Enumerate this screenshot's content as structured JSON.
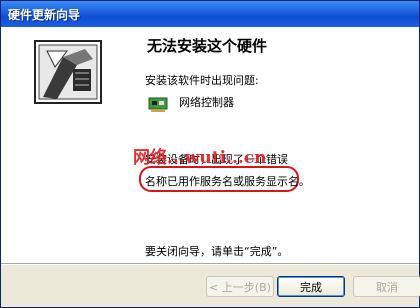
{
  "window": {
    "title": "硬件更新向导"
  },
  "wizard": {
    "heading": "无法安装这个硬件",
    "problem_label": "安装该软件时出现问题:",
    "device": {
      "name": "网络控制器",
      "icon": "network-card-icon"
    },
    "error_line1": "安装设备时，出现了一个错误",
    "error_line2": "名称已用作服务名或服务显示名。",
    "watermark": "网络...wuti...cn",
    "finish_hint": "要关闭向导，请单击“完成”。"
  },
  "buttons": {
    "back": "< 上一步(B)",
    "finish": "完成",
    "cancel": "取消"
  },
  "colors": {
    "titlebar": "#1f63e0",
    "highlight": "#d8141c",
    "watermark": "#e01e26"
  }
}
